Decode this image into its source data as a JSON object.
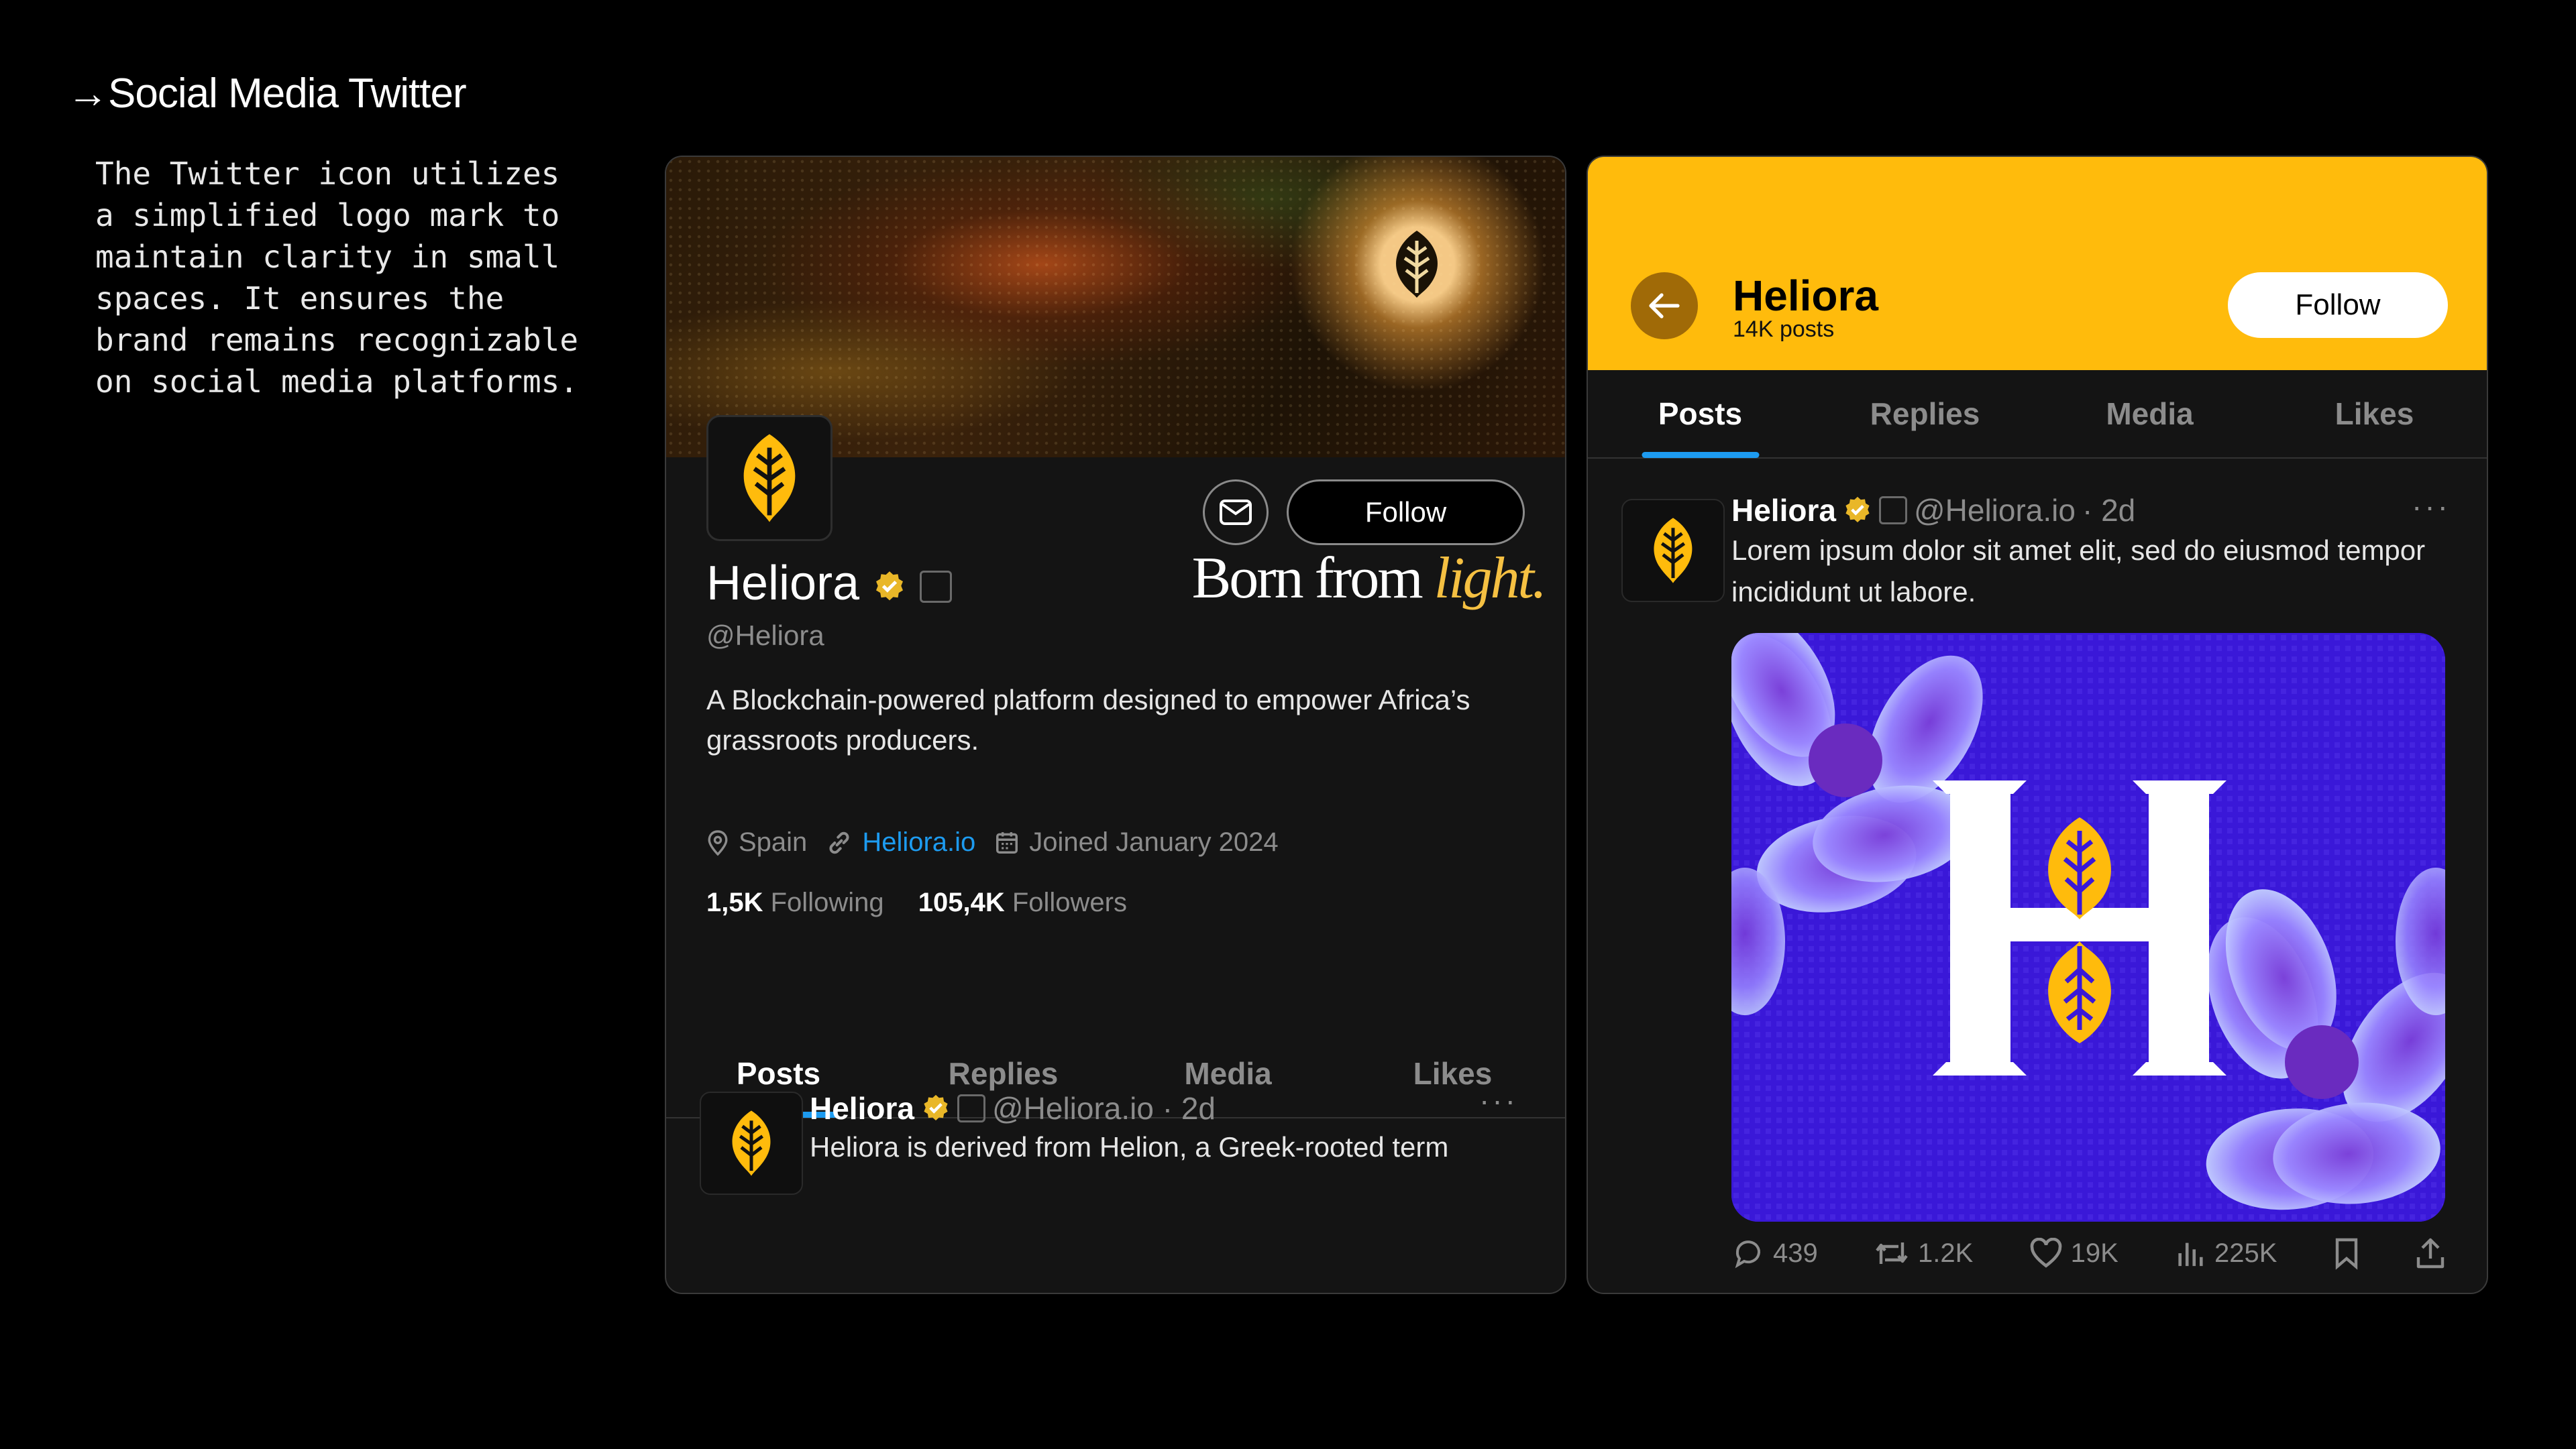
{
  "section": {
    "title": "→Social Media Twitter",
    "description": "The Twitter icon utilizes\na simplified logo mark to\nmaintain clarity in small\nspaces. It ensures the\nbrand remains recognizable\non social media platforms."
  },
  "profile": {
    "banner_tagline_main": "Born from ",
    "banner_tagline_accent": "light.",
    "follow_label": "Follow",
    "name": "Heliora",
    "handle": "@Heliora",
    "bio": "A Blockchain-powered platform designed to empower Africa’s grassroots producers.",
    "location": "Spain",
    "website": "Heliora.io",
    "joined": "Joined January 2024",
    "following_count": "1,5K",
    "following_label": "Following",
    "followers_count": "105,4K",
    "followers_label": "Followers",
    "tabs": [
      "Posts",
      "Replies",
      "Media",
      "Likes"
    ],
    "post": {
      "name": "Heliora",
      "handle": "@Heliora.io · 2d",
      "text": "Heliora is derived from Helion, a Greek-rooted term",
      "more": "···"
    }
  },
  "feed": {
    "header_name": "Heliora",
    "header_sub": "14K posts",
    "follow_label": "Follow",
    "tabs": [
      "Posts",
      "Replies",
      "Media",
      "Likes"
    ],
    "post": {
      "name": "Heliora",
      "handle": "@Heliora.io",
      "time": "· 2d",
      "text": "Lorem ipsum dolor sit amet elit, sed do eiusmod tempor incididunt ut labore.",
      "more": "···"
    },
    "actions": {
      "replies": "439",
      "reposts": "1.2K",
      "likes": "19K",
      "views": "225K"
    }
  },
  "colors": {
    "brand_yellow": "#ffbb0c",
    "accent_blue": "#1d9bf0",
    "image_purple": "#3a18d8"
  }
}
